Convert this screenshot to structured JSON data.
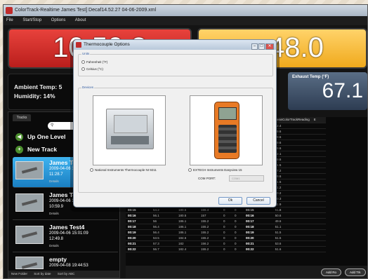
{
  "window": {
    "title": "ColorTrack-Realtime James Test] Decaf14.52.27 04-06-2009.xml"
  },
  "menu": [
    "File",
    "Start/Stop",
    "Options",
    "About"
  ],
  "temps": {
    "left": "10.50.8",
    "right": "48.0"
  },
  "ambient": {
    "temp_label": "Ambient Temp: 5",
    "humidity_label": "Humidity: 14%"
  },
  "exhaust": {
    "label": "Exhaust Temp (°F)",
    "value": "67.1"
  },
  "tracks": {
    "tab": "Tracks",
    "up_label": "Up One Level",
    "new_label": "New Track",
    "items": [
      {
        "name": "James Test",
        "date": "2009-04-06 14",
        "duration": "11:28.7",
        "details": "Details"
      },
      {
        "name": "James Test",
        "date": "2009-04-06 14",
        "duration": "10:59.9",
        "details": "Details"
      },
      {
        "name": "James Test4",
        "date": "2009-04-06 15:01:09",
        "duration": "12:49.8",
        "details": "Details"
      },
      {
        "name": "empty",
        "date": "2009-04-08 19:44:53",
        "duration": "",
        "details": ""
      }
    ],
    "footer": [
      "New Folder",
      "Sort by date",
      "Sort by ABC"
    ]
  },
  "grid": {
    "headers": [
      "",
      "",
      "",
      "",
      "",
      "",
      "ComElapsedTime",
      "BeanColorTrackReading",
      "E"
    ],
    "right_rows": [
      [
        "00:00",
        "52.4"
      ],
      [
        "00:01",
        "49.6"
      ],
      [
        "00:02",
        "49.6"
      ],
      [
        "00:03",
        "49.6"
      ],
      [
        "00:04",
        "49.6"
      ],
      [
        "00:05",
        "52.1"
      ],
      [
        "00:06",
        "49.6"
      ],
      [
        "00:07",
        "51.5"
      ],
      [
        "00:08",
        "47.2"
      ],
      [
        "00:09",
        "49.6"
      ],
      [
        "00:10",
        "51.5"
      ],
      [
        "00:11",
        "51.2"
      ],
      [
        "00:12",
        "50.2"
      ],
      [
        "00:13",
        "50.3"
      ]
    ],
    "rows": [
      [
        "00:14",
        "57.4",
        "180.5",
        "155.4",
        "0",
        "0",
        "00:14",
        "51.9"
      ],
      [
        "00:15",
        "54.2",
        "180.5",
        "155.4",
        "0",
        "0",
        "00:15",
        "51.8"
      ],
      [
        "00:16",
        "56.1",
        "180.5",
        "157",
        "0",
        "0",
        "00:16",
        "50.6"
      ],
      [
        "00:17",
        "56",
        "186.1",
        "155.2",
        "0",
        "0",
        "00:17",
        "49.6"
      ],
      [
        "00:18",
        "56.4",
        "186.1",
        "155.2",
        "0",
        "0",
        "00:18",
        "51.1"
      ],
      [
        "00:19",
        "56.4",
        "186.1",
        "155.2",
        "0",
        "0",
        "00:19",
        "51.5"
      ],
      [
        "00:20",
        "53.5",
        "184.6",
        "155.2",
        "0",
        "0",
        "00:20",
        "51.5"
      ],
      [
        "00:21",
        "57.3",
        "182",
        "156.2",
        "0",
        "0",
        "00:21",
        "53.6"
      ],
      [
        "00:22",
        "56.7",
        "182.4",
        "155.2",
        "0",
        "0",
        "00:22",
        "51.6"
      ]
    ]
  },
  "bottom": {
    "add_btn": "Add Ro",
    "add_trk": "Add Trk"
  },
  "dialog": {
    "title": "Thermocouple Options",
    "units_label": "Units",
    "fahrenheit": "Fahrenheit (°F)",
    "celsius": "Celsius (°C)",
    "devices_label": "Devices",
    "device1": "National Instruments Thermocouple NI 9211",
    "device2": "EXTECH Instruments Easyview 15",
    "com_label": "COM PORT:",
    "com_placeholder": "COM1",
    "ok": "Ok",
    "cancel": "Cancel"
  }
}
